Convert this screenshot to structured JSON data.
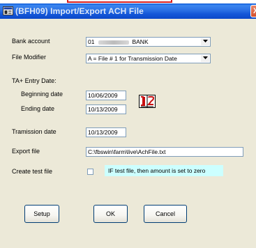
{
  "window": {
    "title": "(BFH09)  Import/Export ACH File",
    "close_glyph": "X"
  },
  "form": {
    "bank_account": {
      "label": "Bank account",
      "value_prefix": "01",
      "value_suffix": "BANK"
    },
    "file_modifier": {
      "label": "File Modifier",
      "value": "A = File # 1 for Transmission Date"
    },
    "ta_entry_date": {
      "label": "TA+ Entry Date:",
      "beginning_label": "Beginning date",
      "beginning_value": "10/06/2009",
      "ending_label": "Ending date",
      "ending_value": "10/13/2009"
    },
    "transmission_date": {
      "label": "Tramission date",
      "value": "10/13/2009"
    },
    "export_file": {
      "label": "Export file",
      "value": "C:\\fbswin\\farm\\live\\AchFile.txt"
    },
    "create_test_file": {
      "label": "Create test file",
      "checked": false,
      "info": "IF test file, then amount is set to zero"
    }
  },
  "buttons": {
    "setup": "Setup",
    "ok": "OK",
    "cancel": "Cancel"
  },
  "icons": {
    "app": "app-window-icon",
    "calendar": "calendar-icon",
    "dropdown": "chevron-down-icon"
  },
  "colors": {
    "titlebar": "#2a6fe4",
    "dialog_bg": "#ece9d8",
    "info_bg": "#ccffff",
    "calendar_red": "#c81010",
    "close_button": "#d3502c"
  }
}
